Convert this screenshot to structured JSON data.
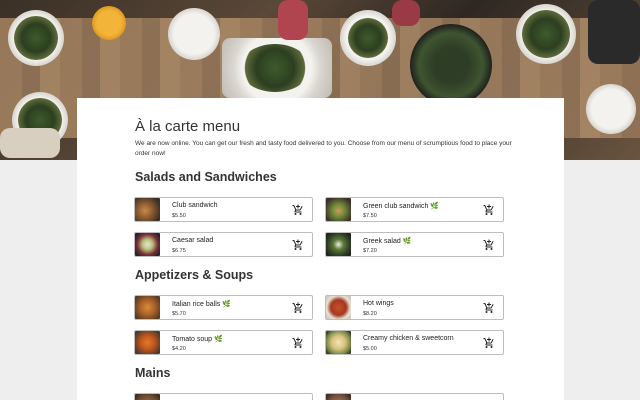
{
  "page": {
    "title": "À la carte menu",
    "intro": "We are now online. You can get our fresh and tasty food delivered to you. Choose from our menu of scrumptious food to place your order now!"
  },
  "colors": {
    "accent_leaf": "#6aa23a",
    "border": "#bdbdbd",
    "background": "#eeeeee"
  },
  "sections": [
    {
      "title": "Salads and Sandwiches",
      "items": [
        {
          "name": "Club sandwich",
          "price": "$5.50",
          "vegetarian": false,
          "icon": "cart-add-icon"
        },
        {
          "name": "Green club sandwich",
          "price": "$7.50",
          "vegetarian": true,
          "icon": "cart-add-icon"
        },
        {
          "name": "Caesar salad",
          "price": "$6.75",
          "vegetarian": false,
          "icon": "cart-add-icon"
        },
        {
          "name": "Greek salad",
          "price": "$7.20",
          "vegetarian": true,
          "icon": "cart-add-icon"
        }
      ]
    },
    {
      "title": "Appetizers & Soups",
      "items": [
        {
          "name": "Italian rice balls",
          "price": "$5.70",
          "vegetarian": true,
          "icon": "cart-add-icon"
        },
        {
          "name": "Hot wings",
          "price": "$8.20",
          "vegetarian": false,
          "icon": "cart-add-icon"
        },
        {
          "name": "Tomato soup",
          "price": "$4.20",
          "vegetarian": true,
          "icon": "cart-add-icon"
        },
        {
          "name": "Creamy chicken & sweetcorn",
          "price": "$5.00",
          "vegetarian": false,
          "icon": "cart-add-icon"
        }
      ]
    },
    {
      "title": "Mains",
      "items": []
    }
  ],
  "leaf_glyph": "🌿"
}
